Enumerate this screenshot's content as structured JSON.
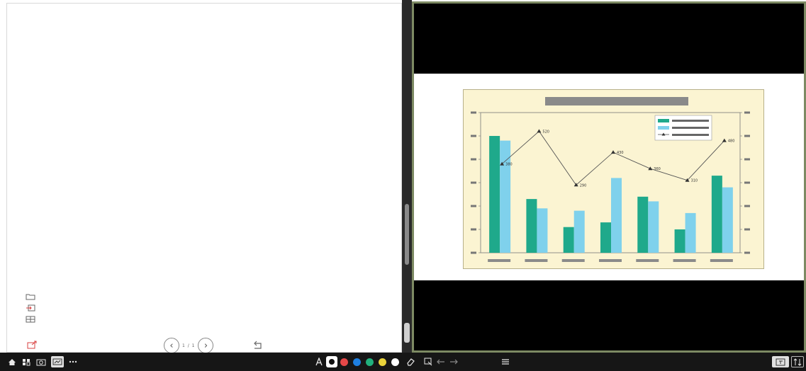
{
  "left_pane": {
    "tools": [
      {
        "icon": "folder-icon"
      },
      {
        "icon": "import-icon"
      },
      {
        "icon": "grid-icon"
      }
    ],
    "export_icon": "export-icon",
    "pager": {
      "text": "1 / 1"
    },
    "undo_icon": "undo-icon"
  },
  "chart_data": {
    "type": "bar",
    "categories": [
      "",
      "",
      "",
      "",
      "",
      "",
      ""
    ],
    "bar_series": [
      {
        "color": "#1fa98b",
        "values": [
          500,
          230,
          110,
          130,
          240,
          100,
          330
        ]
      },
      {
        "color": "#7fd1ec",
        "values": [
          480,
          190,
          180,
          320,
          220,
          170,
          280
        ]
      }
    ],
    "line_series": {
      "color": "#555555",
      "values": [
        380,
        520,
        290,
        430,
        360,
        310,
        480
      ],
      "data_labels": [
        "380",
        "520",
        "290",
        "430",
        "360",
        "310",
        "480"
      ]
    },
    "ylim": [
      0,
      600
    ],
    "y_ticks": [
      0,
      100,
      200,
      300,
      400,
      500,
      600
    ],
    "y2_ticks": [
      0,
      100,
      200,
      300,
      400,
      500,
      600
    ],
    "grid": false,
    "legend": "top-right",
    "colors": {
      "bg": "#fbf4d2",
      "title_bar": "#8a8a8a",
      "label_bar": "#8a8a8a"
    }
  },
  "taskbar": {
    "left_icons": [
      "home-icon",
      "apps-icon",
      "camera-icon",
      "whiteboard-icon",
      "more-icon"
    ],
    "center_tools": [
      "text-tool-icon",
      "pen-tool-icon"
    ],
    "palette": [
      "#e54848",
      "#1e7fe0",
      "#22b07d",
      "#e9d23a",
      "#ffffff"
    ],
    "right_tools": [
      "eraser-icon",
      "select-icon",
      "undo-icon",
      "redo-icon",
      "menu-icon"
    ],
    "far_right": [
      "window-icon",
      "swap-icon"
    ]
  }
}
